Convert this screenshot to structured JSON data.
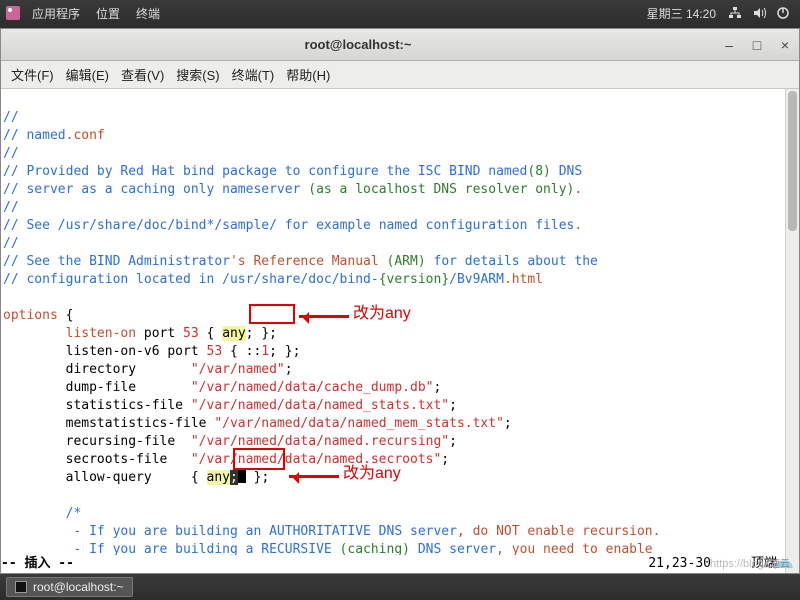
{
  "panel": {
    "menu_apps": "应用程序",
    "menu_places": "位置",
    "menu_terminal": "终端",
    "clock": "星期三 14:20"
  },
  "window": {
    "title": "root@localhost:~"
  },
  "menubar": {
    "file": "文件(F)",
    "edit": "编辑(E)",
    "view": "查看(V)",
    "search": "搜索(S)",
    "terminal": "终端(T)",
    "help": "帮助(H)"
  },
  "code": {
    "l01": "//",
    "l02_a": "// named",
    "l02_b": ".conf",
    "l03": "//",
    "l04_a": "// Provided by Red Hat bind package to configure the ISC BIND named",
    "l04_b": "(8)",
    "l04_c": " DNS",
    "l05_a": "// server as a caching only nameserver ",
    "l05_b": "(as a localhost DNS resolver only)",
    "l05_c": ".",
    "l06": "//",
    "l07_a": "// See ",
    "l07_b": "/usr/share/doc/bind*/sample/",
    "l07_c": " for example named configuration files",
    "l07_d": ".",
    "l08": "//",
    "l09_a": "// See the BIND Administrator",
    "l09_b": "'s Reference Manual ",
    "l09_c": "(ARM)",
    "l09_d": " for details about the",
    "l10_a": "// configuration located in ",
    "l10_b": "/usr/share/doc/bind-",
    "l10_c": "{version}",
    "l10_d": "/Bv9ARM",
    "l10_e": ".html",
    "opt": "options",
    "brace_open": " {",
    "listen": "listen-on",
    "listen_rest_a": " port ",
    "port53": "53",
    "listen_rest_b": " { ",
    "any1": "any",
    "any1_semi": ";",
    "listen_rest_c": " };",
    "listen6_a": "        listen-on-v6 port ",
    "listen6_b": " { ::",
    "one": "1",
    "listen6_c": "; };",
    "dir_a": "        directory       ",
    "dir_b": "\"/var/named\"",
    "semi": ";",
    "dump_a": "        dump-file       ",
    "dump_b": "\"/var/named/data/cache_dump.db\"",
    "stats_a": "        statistics-file ",
    "stats_b": "\"/var/named/data/named_stats.txt\"",
    "mem_a": "        memstatistics-file ",
    "mem_b": "\"/var/named/data/named_mem_stats.txt\"",
    "rec_a": "        recursing-file  ",
    "rec_b": "\"/var/named/data/named.recursing\"",
    "sec_a": "        secroots-file   ",
    "sec_b": "\"/var/named/data/named.secroots\"",
    "allow_a": "        allow-query     { ",
    "any2": "any",
    "any2_semi": ";",
    "allow_b": " };",
    "cmt1": "        /*",
    "cmt2_a": "         - If you are building an AUTHORITATIVE DNS server",
    "cmt2_b": ", do NOT enable recursion.",
    "cmt3_a": "         - If you are building a RECURSIVE ",
    "cmt3_b": "(caching)",
    "cmt3_c": " DNS server",
    "cmt3_d": ", you need to enable"
  },
  "annotations": {
    "label1": "改为any",
    "label2": "改为any"
  },
  "status": {
    "mode": "-- 插入 --",
    "pos": "21,23-30",
    "pct": "顶端"
  },
  "taskbar": {
    "task1": "root@localhost:~"
  },
  "watermark": {
    "blog": "https://blog.csd",
    "cloud": "亿速云"
  }
}
